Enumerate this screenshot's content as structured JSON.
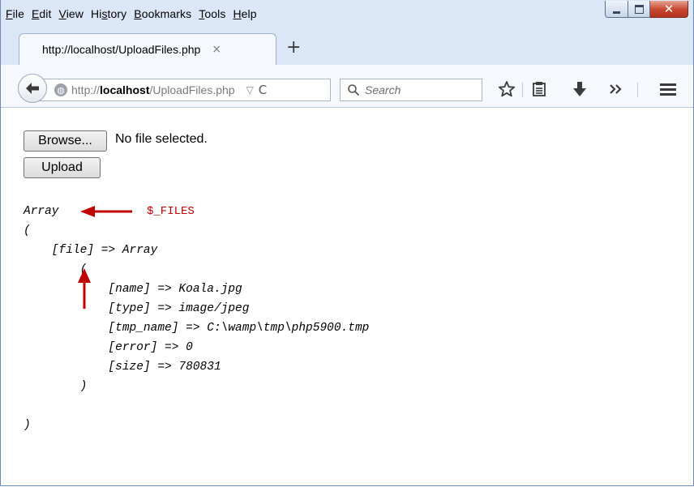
{
  "menubar": {
    "items": [
      {
        "mnemonic": "F",
        "rest": "ile"
      },
      {
        "mnemonic": "E",
        "rest": "dit"
      },
      {
        "mnemonic": "V",
        "rest": "iew"
      },
      {
        "pre": "Hi",
        "mnemonic": "s",
        "rest": "tory"
      },
      {
        "mnemonic": "B",
        "rest": "ookmarks"
      },
      {
        "mnemonic": "T",
        "rest": "ools"
      },
      {
        "mnemonic": "H",
        "rest": "elp"
      }
    ]
  },
  "tab": {
    "title": "http://localhost/UploadFiles.php",
    "close_glyph": "×"
  },
  "newtab_glyph": "+",
  "urlbar": {
    "prefix": "http://",
    "host": "localhost",
    "path": "/UploadFiles.php",
    "drop_glyph": "▽",
    "reload_glyph": "C"
  },
  "search": {
    "placeholder": "Search"
  },
  "toolbar_icons": [
    "back-arrow-icon",
    "star-icon",
    "reading-list-icon",
    "download-icon",
    "overflow-chevron-icon",
    "hamburger-menu-icon"
  ],
  "content": {
    "browse_label": "Browse...",
    "file_status": "No file selected.",
    "upload_label": "Upload",
    "dump_lines": [
      "Array",
      "(",
      "    [file] => Array",
      "        (",
      "            [name] => Koala.jpg",
      "            [type] => image/jpeg",
      "            [tmp_name] => C:\\wamp\\tmp\\php5900.tmp",
      "            [error] => 0",
      "            [size] => 780831",
      "        )",
      "",
      ")"
    ],
    "annotation_label": "$_FILES",
    "annotation_color": "#c00000"
  },
  "colors": {
    "chrome": "#dbe7f6",
    "close_button": "#c6452d"
  }
}
